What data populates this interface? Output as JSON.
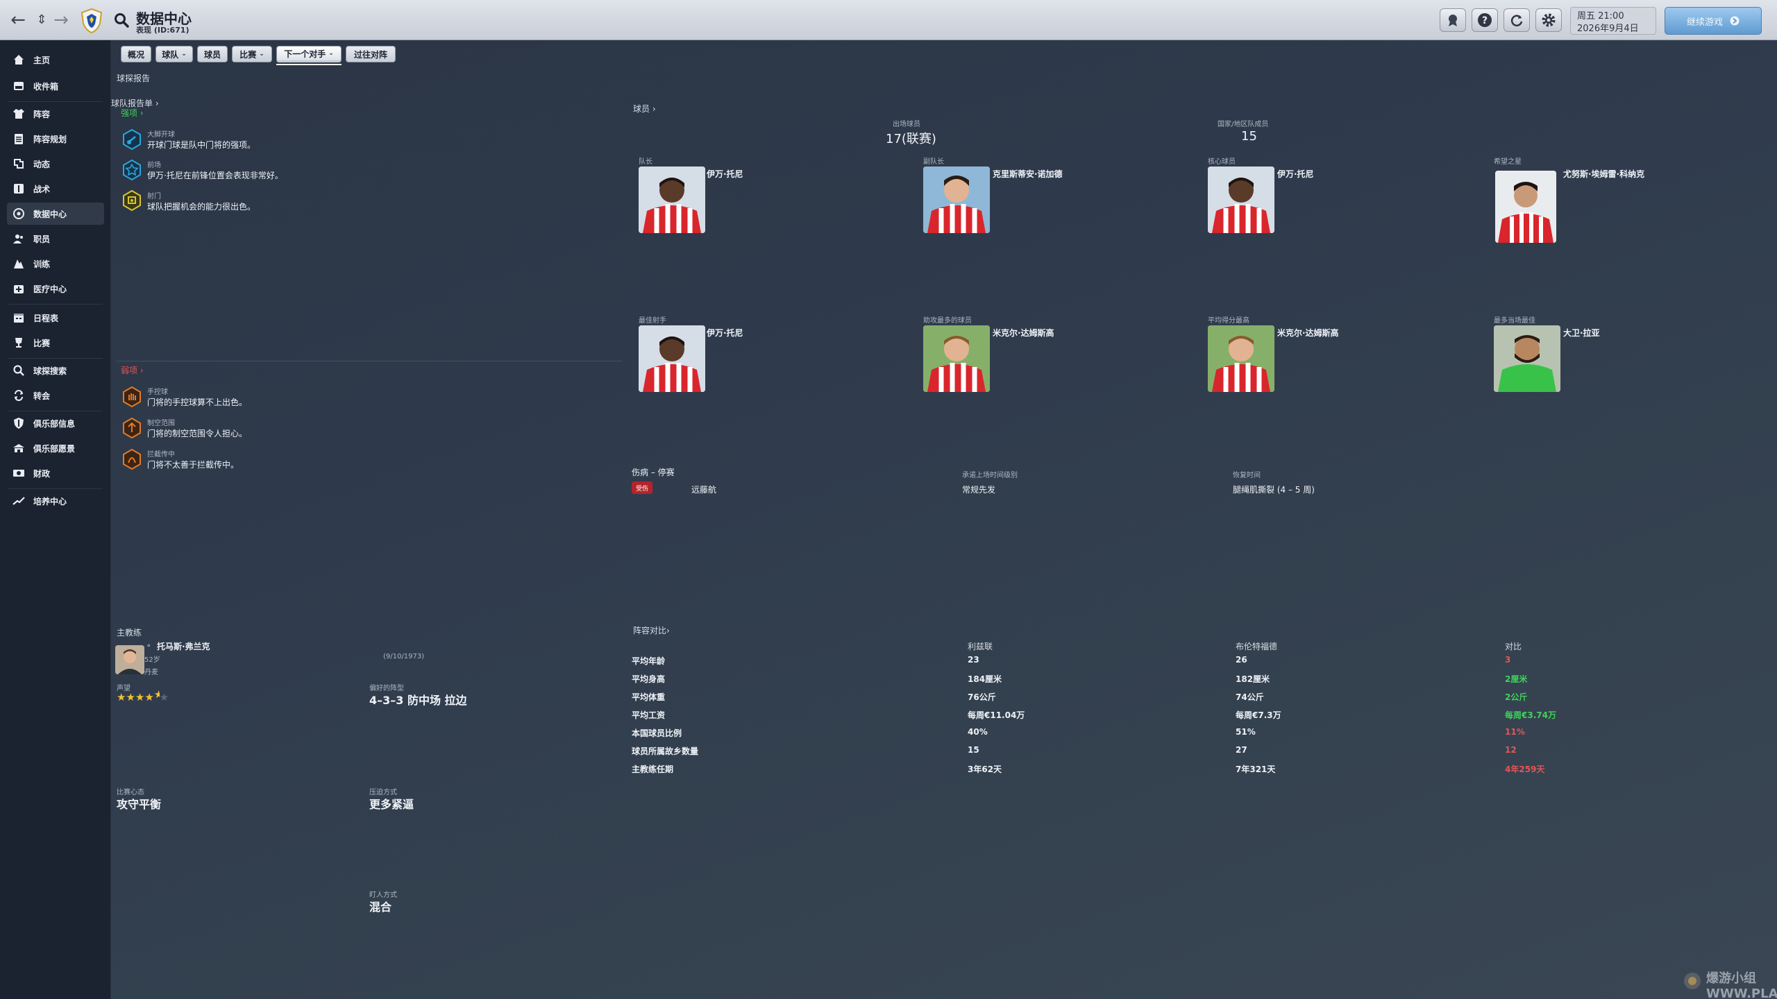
{
  "header": {
    "title": "数据中心",
    "subtitle": "表现 (ID:671)",
    "date_line1": "周五 21:00",
    "date_line2": "2026年9月4日",
    "continue_label": "继续游戏"
  },
  "sidebar": {
    "items": [
      {
        "label": "主页",
        "icon": "home-icon"
      },
      {
        "label": "收件箱",
        "icon": "inbox-icon"
      },
      {
        "label": "阵容",
        "icon": "shirt-icon"
      },
      {
        "label": "阵容规划",
        "icon": "clipboard-icon"
      },
      {
        "label": "动态",
        "icon": "dynamics-icon"
      },
      {
        "label": "战术",
        "icon": "tactics-icon"
      },
      {
        "label": "数据中心",
        "icon": "data-hub-icon"
      },
      {
        "label": "职员",
        "icon": "staff-icon"
      },
      {
        "label": "训练",
        "icon": "training-icon"
      },
      {
        "label": "医疗中心",
        "icon": "medical-icon"
      },
      {
        "label": "日程表",
        "icon": "calendar-icon"
      },
      {
        "label": "比赛",
        "icon": "trophy-icon"
      },
      {
        "label": "球探搜索",
        "icon": "scouting-search-icon"
      },
      {
        "label": "转会",
        "icon": "transfer-icon"
      },
      {
        "label": "俱乐部信息",
        "icon": "club-shield-icon"
      },
      {
        "label": "俱乐部愿景",
        "icon": "club-vision-icon"
      },
      {
        "label": "财政",
        "icon": "finance-icon"
      },
      {
        "label": "培养中心",
        "icon": "development-icon"
      }
    ]
  },
  "tabs": [
    {
      "label": "概况",
      "dropdown": false
    },
    {
      "label": "球队",
      "dropdown": true
    },
    {
      "label": "球员",
      "dropdown": false
    },
    {
      "label": "比赛",
      "dropdown": true
    },
    {
      "label": "下一个对手",
      "dropdown": true
    },
    {
      "label": "过往对阵",
      "dropdown": false
    }
  ],
  "report": {
    "section_title": "球探报告",
    "team_report_link": "球队报告单",
    "strengths_link": "强项",
    "strengths": [
      {
        "title": "大脚开球",
        "text": "开球门球是队中门将的强项。",
        "color": "#2aa7d9"
      },
      {
        "title": "前场",
        "text": "伊万·托尼在前锋位置会表现非常好。",
        "color": "#2aa7d9"
      },
      {
        "title": "射门",
        "text": "球队把握机会的能力很出色。",
        "color": "#d8c533"
      }
    ],
    "weakness_link": "弱项",
    "weaknesses": [
      {
        "title": "手控球",
        "text": "门将的手控球算不上出色。"
      },
      {
        "title": "制空范围",
        "text": "门将的制空范围令人担心。"
      },
      {
        "title": "拦截传中",
        "text": "门将不太善于拦截传中。"
      }
    ]
  },
  "players": {
    "link": "球员",
    "appearances_label": "出场球员",
    "appearances_value": "17(联赛)",
    "internationals_label": "国家/地区队成员",
    "internationals_value": "15",
    "cards": [
      {
        "role": "队长",
        "name": "伊万·托尼",
        "kit": "stripes"
      },
      {
        "role": "副队长",
        "name": "克里斯蒂安·诺加德",
        "kit": "stripes"
      },
      {
        "role": "核心球员",
        "name": "伊万·托尼",
        "kit": "stripes"
      },
      {
        "role": "希望之星",
        "name": "尤努斯·埃姆雷·科纳克",
        "kit": "stripes"
      },
      {
        "role": "最佳射手",
        "name": "伊万·托尼",
        "kit": "stripes"
      },
      {
        "role": "助攻最多的球员",
        "name": "米克尔·达姆斯高",
        "kit": "stripes"
      },
      {
        "role": "平均得分最高",
        "name": "米克尔·达姆斯高",
        "kit": "stripes"
      },
      {
        "role": "最多当场最佳",
        "name": "大卫·拉亚",
        "kit": "green"
      }
    ]
  },
  "injuries": {
    "header": "伤病 – 停赛",
    "return_label": "承诺上场时间级别",
    "recovery_label": "恢复时间",
    "rows": [
      {
        "badge": "受伤",
        "name": "远藤航",
        "playing_time": "常规先发",
        "recovery": "腿绳肌撕裂 (4 – 5 周)"
      }
    ]
  },
  "manager": {
    "section_title": "主教练",
    "name": "托马斯·弗兰克",
    "age": "52岁",
    "nation": "丹麦",
    "dob": "(9/10/1973)",
    "reputation_label": "声望",
    "stars": "★★★★",
    "half_star": "★",
    "empty_star": "★",
    "formation_label": "偏好的阵型",
    "formation_value": "4–3–3 防中场 拉边",
    "mentality_label": "比赛心态",
    "mentality_value": "攻守平衡",
    "pressing_label": "压迫方式",
    "pressing_value": "更多紧逼",
    "marking_label": "盯人方式",
    "marking_value": "混合"
  },
  "comparison": {
    "link": "阵容对比",
    "col_team1": "利兹联",
    "col_team2": "布伦特福德",
    "col_diff": "对比",
    "rows": [
      {
        "label": "平均年龄",
        "v1": "23",
        "v2": "26",
        "diff": "3",
        "good": false
      },
      {
        "label": "平均身高",
        "v1": "184厘米",
        "v2": "182厘米",
        "diff": "2厘米",
        "good": true
      },
      {
        "label": "平均体重",
        "v1": "76公斤",
        "v2": "74公斤",
        "diff": "2公斤",
        "good": true
      },
      {
        "label": "平均工资",
        "v1": "每周€11.04万",
        "v2": "每周€7.3万",
        "diff": "每周€3.74万",
        "good": true
      },
      {
        "label": "本国球员比例",
        "v1": "40%",
        "v2": "51%",
        "diff": "11%",
        "good": false
      },
      {
        "label": "球员所属故乡数量",
        "v1": "15",
        "v2": "27",
        "diff": "12",
        "good": false
      },
      {
        "label": "主教练任期",
        "v1": "3年62天",
        "v2": "7年321天",
        "diff": "4年259天",
        "good": false
      }
    ]
  },
  "watermark": "爆游小组 WWW.PLAYSM.CC",
  "colors": {
    "accent_green": "#3fd25b",
    "accent_red": "#e35656",
    "injury_badge": "#b6232b"
  }
}
